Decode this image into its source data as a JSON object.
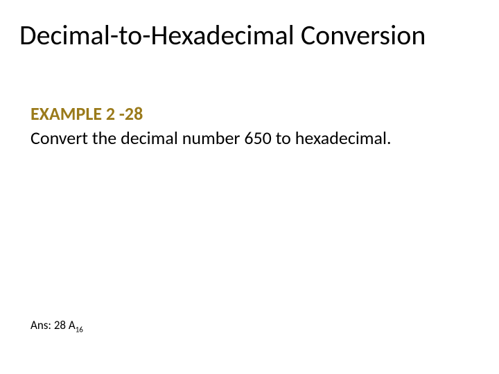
{
  "title": "Decimal-to-Hexadecimal Conversion",
  "example_label": "EXAMPLE 2 -28",
  "prompt": "Convert the decimal number 650 to hexadecimal.",
  "answer_prefix": "Ans:  ",
  "answer_value": "28 A",
  "answer_subscript": "16"
}
